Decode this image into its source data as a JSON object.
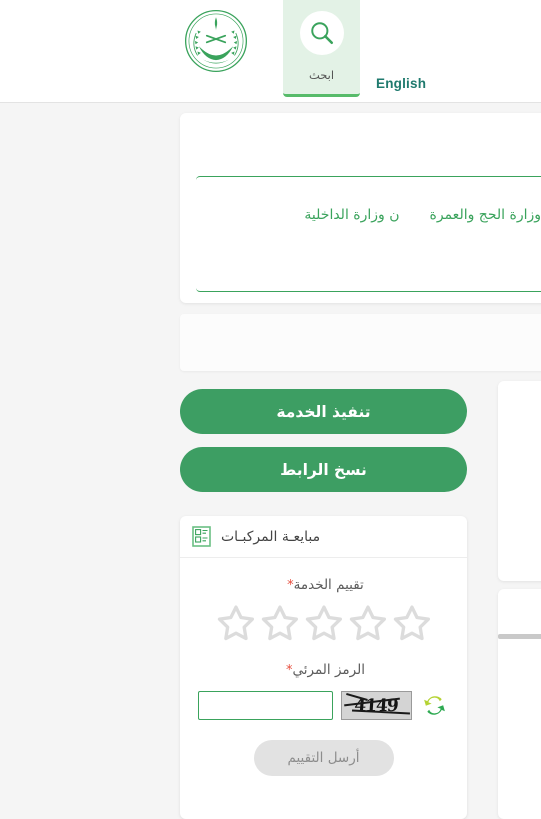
{
  "header": {
    "emblem_name": "saudi-ministry-of-interior-emblem",
    "search_tab": {
      "icon": "search-icon",
      "label": "ابحث"
    },
    "language_link": "English"
  },
  "tabs_card": {
    "tabs": [
      {
        "label": "وزارة الحج والعمرة"
      },
      {
        "label": "ن وزارة الداخلية"
      }
    ]
  },
  "actions": {
    "execute_label": "تنفيذ الخدمة",
    "copy_link_label": "نسخ الرابط"
  },
  "rating_card": {
    "icon": "document-form-icon",
    "title": "مبايعـة المركبـات",
    "rating_label": "تقييم الخدمة",
    "required_mark": "*",
    "stars": {
      "total": 5,
      "selected": 0,
      "empty_color": "#dcdcdc"
    },
    "captcha": {
      "label": "الرمز المرئي",
      "required_mark": "*",
      "refresh_icon": "refresh-icon",
      "code_text": "4149",
      "input_value": "",
      "input_placeholder": ""
    },
    "submit_label": "أرسل التقييم"
  },
  "colors": {
    "brand_green": "#3d9e63",
    "accent_green": "#3aa35c",
    "tab_bg": "#e3f2e6",
    "teal_link": "#1f7a6e",
    "page_bg": "#f5f5f5",
    "required_red": "#e74c3c",
    "disabled_gray": "#e2e2e2"
  }
}
